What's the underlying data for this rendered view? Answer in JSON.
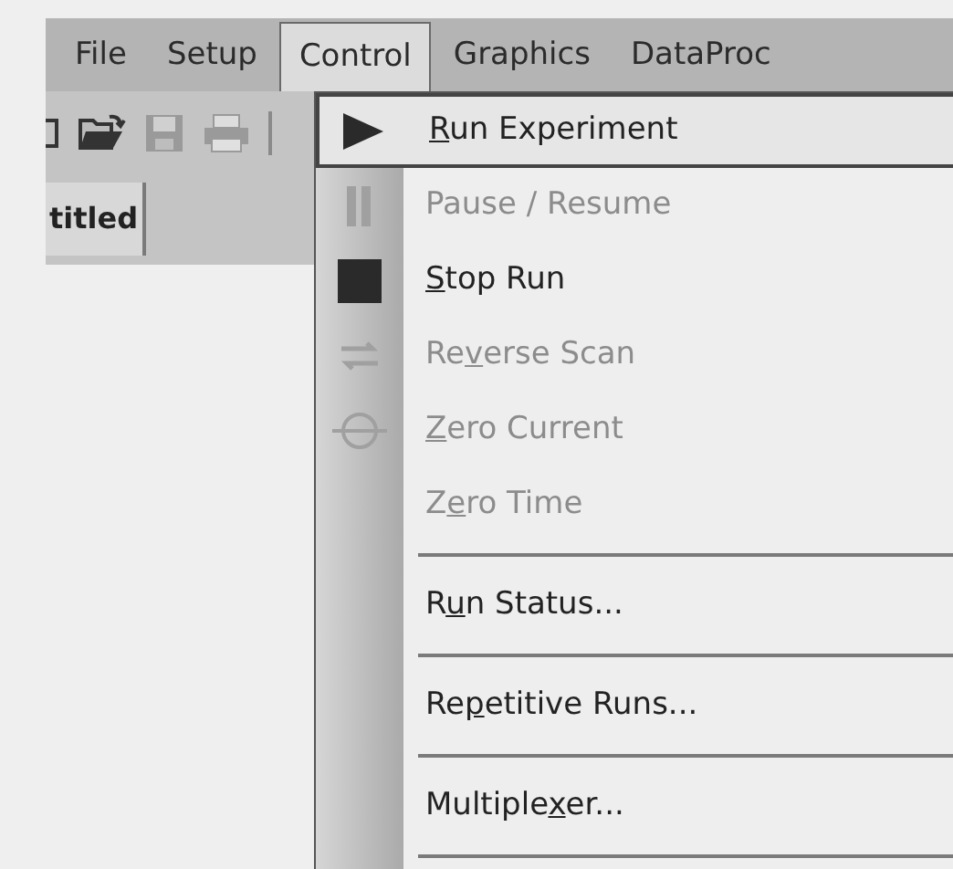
{
  "menubar": [
    {
      "label": "File",
      "selected": false
    },
    {
      "label": "Setup",
      "selected": false
    },
    {
      "label": "Control",
      "selected": true
    },
    {
      "label": "Graphics",
      "selected": false
    },
    {
      "label": "DataProc",
      "selected": false
    }
  ],
  "toolbar": [
    {
      "kind": "new",
      "disabled": false
    },
    {
      "kind": "open",
      "disabled": false
    },
    {
      "kind": "save",
      "disabled": true
    },
    {
      "kind": "print",
      "disabled": true
    }
  ],
  "document_tab": {
    "label": "titled"
  },
  "menu": [
    {
      "kind": "play",
      "key": "R",
      "after": "un Experiment",
      "disabled": false,
      "selected": true
    },
    {
      "kind": "pause",
      "before": "Pause / Resume",
      "disabled": true,
      "selected": false
    },
    {
      "kind": "stop",
      "key": "S",
      "after": "top Run",
      "disabled": false,
      "selected": false
    },
    {
      "kind": "reverse",
      "before": "Re",
      "key": "v",
      "after": "erse Scan",
      "disabled": true,
      "selected": false
    },
    {
      "kind": "zero",
      "key": "Z",
      "after": "ero Current",
      "disabled": true,
      "selected": false
    },
    {
      "kind": "plain",
      "before": "Z",
      "key": "e",
      "after": "ro Time",
      "disabled": true,
      "selected": false
    },
    {
      "kind": "separator"
    },
    {
      "kind": "plain",
      "before": "R",
      "key": "u",
      "after": "n Status...",
      "disabled": false,
      "selected": false
    },
    {
      "kind": "separator"
    },
    {
      "kind": "plain",
      "before": "Re",
      "key": "p",
      "after": "etitive Runs...",
      "disabled": false,
      "selected": false
    },
    {
      "kind": "separator"
    },
    {
      "kind": "plain",
      "before": "Multiple",
      "key": "x",
      "after": "er...",
      "disabled": false,
      "selected": false
    },
    {
      "kind": "separator"
    }
  ]
}
